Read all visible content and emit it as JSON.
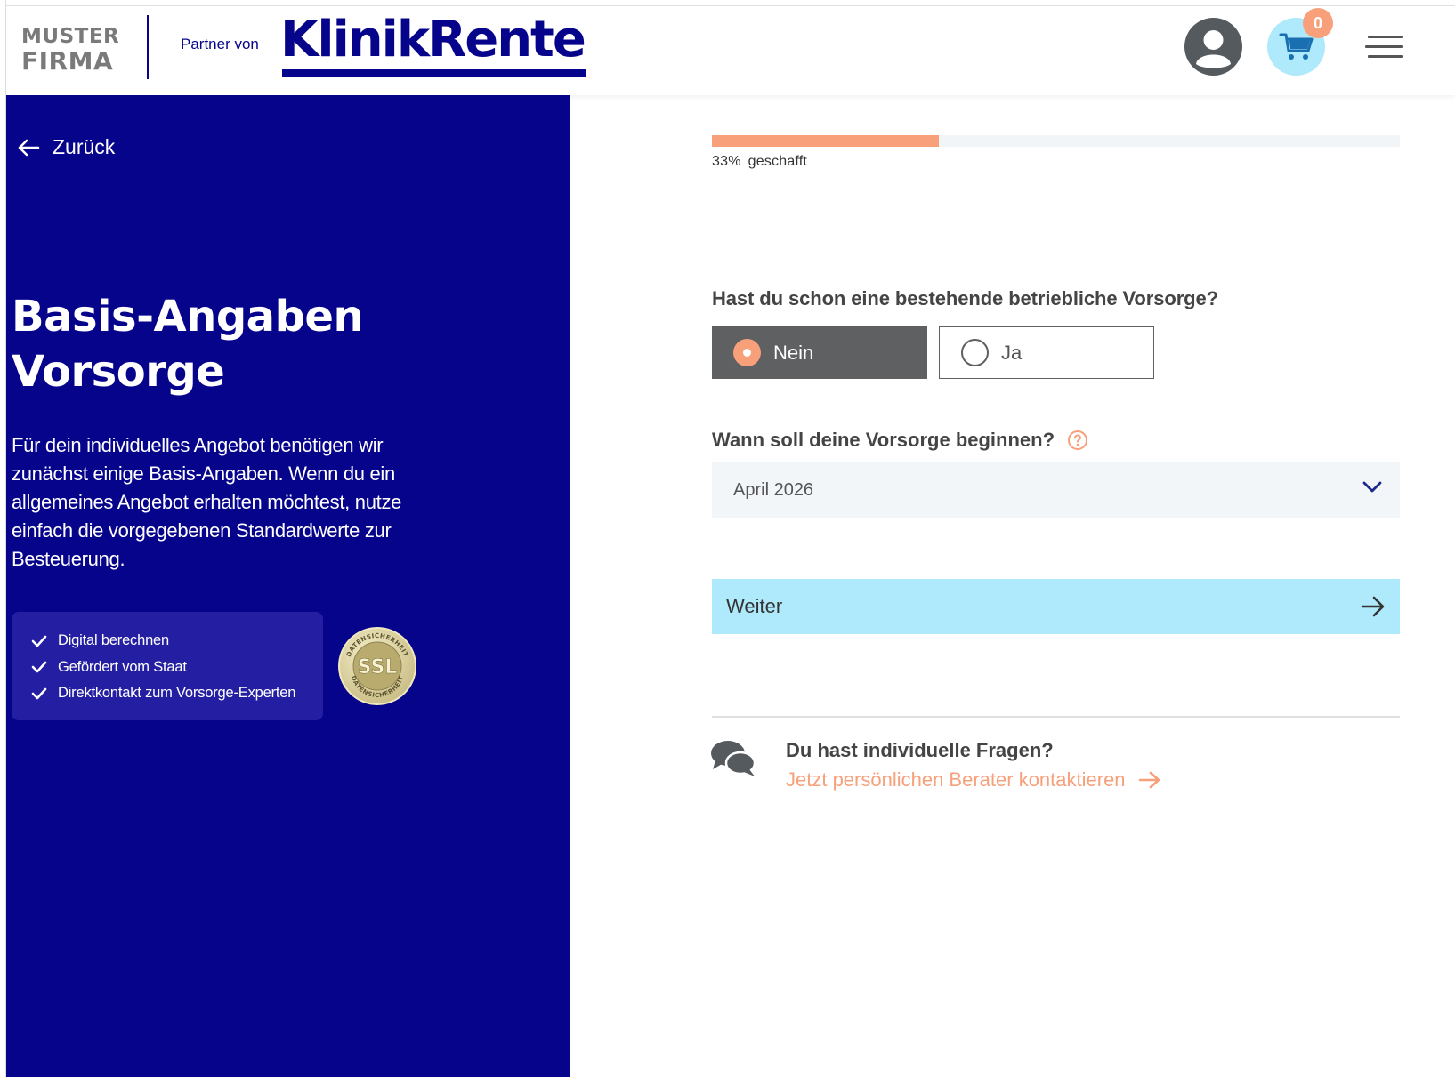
{
  "header": {
    "company_logo_line1": "MUSTER",
    "company_logo_line2": "FIRMA",
    "partner_label": "Partner von",
    "brand_name": "KlinikRente",
    "cart_count": "0",
    "icons": {
      "profile": "user-icon",
      "cart": "cart-icon",
      "menu": "hamburger-menu-icon"
    },
    "colors": {
      "brand_navy": "#07048c",
      "cart_circle": "#aeeafb",
      "badge": "#f7a07a"
    }
  },
  "left_panel": {
    "back_label": "Zurück",
    "title_line1": "Basis-Angaben",
    "title_line2": "Vorsorge",
    "description": "Für dein individuelles Angebot benötigen wir zunächst einige Basis-Angaben. Wenn du ein allgemeines Angebot erhalten möchtest, nutze einfach die vorgegebenen Standardwerte zur Besteuerung.",
    "features": [
      "Digital berechnen",
      "Gefördert vom Staat",
      "Direktkontakt zum Vorsorge-Experten"
    ],
    "ssl_seal": {
      "center": "SSL",
      "ring": "DATENSICHERHEIT"
    },
    "background": "#07048c"
  },
  "form": {
    "progress": {
      "percent": 33,
      "percent_label": "33%",
      "suffix": "geschafft",
      "fill_color": "#f7a07a"
    },
    "question1": {
      "label": "Hast du schon eine bestehende betriebliche Vorsorge?",
      "options": [
        "Nein",
        "Ja"
      ],
      "selected": "Nein"
    },
    "question2": {
      "label": "Wann soll deine Vorsorge beginnen?",
      "selected_value": "April 2026",
      "help_icon": "question-circle-icon"
    },
    "next_button": {
      "label": "Weiter",
      "icon": "arrow-right-icon",
      "color": "#aeeafb"
    }
  },
  "contact": {
    "question": "Du hast individuelle Fragen?",
    "link_label": "Jetzt persönlichen Berater kontaktieren",
    "icon": "chat-bubbles-icon",
    "link_color": "#f7a07a"
  }
}
